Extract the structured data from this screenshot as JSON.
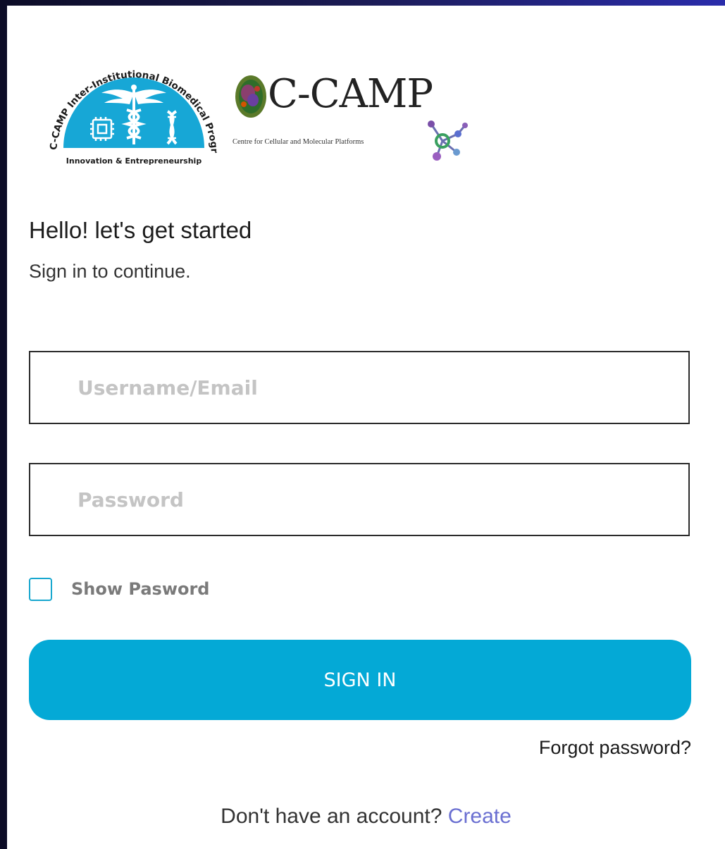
{
  "logos": {
    "ibp": {
      "arc_text": "C-CAMP Inter-Institutional Biomedical Programme",
      "tagline": "Innovation & Entrepreneurship",
      "accent_color": "#17a7d6"
    },
    "ccamp": {
      "name": "C-CAMP",
      "subtitle": "Centre for Cellular and Molecular Platforms"
    }
  },
  "heading": {
    "title": "Hello! let's get started",
    "subtitle": "Sign in to continue."
  },
  "form": {
    "username": {
      "placeholder": "Username/Email",
      "value": ""
    },
    "password": {
      "placeholder": "Password",
      "value": ""
    },
    "show_password": {
      "label": "Show Pasword",
      "checked": false
    },
    "signin_label": "SIGN IN",
    "forgot_label": "Forgot password?"
  },
  "footer": {
    "prompt": "Don't have an account?",
    "create_label": "Create"
  },
  "colors": {
    "primary": "#04a9d6",
    "link": "#6a6fd1",
    "checkbox_border": "#17a7cf"
  }
}
